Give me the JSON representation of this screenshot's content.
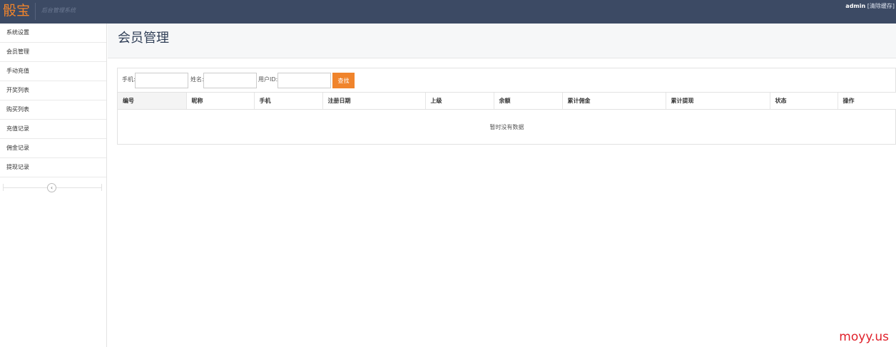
{
  "header": {
    "logo": "骰宝",
    "subtitle": "后台管理系统",
    "user": "admin",
    "clear_cache": "[清除缓存]"
  },
  "sidebar": {
    "items": [
      {
        "label": "系统设置"
      },
      {
        "label": "会员管理"
      },
      {
        "label": "手动充值"
      },
      {
        "label": "开奖列表"
      },
      {
        "label": "购买列表"
      },
      {
        "label": "充值记录"
      },
      {
        "label": "佣金记录"
      },
      {
        "label": "提现记录"
      }
    ],
    "collapse_icon": "chevron-left-icon"
  },
  "page": {
    "title": "会员管理"
  },
  "search": {
    "phone_label": "手机:",
    "phone_value": "",
    "name_label": "姓名:",
    "name_value": "",
    "userid_label": "用户ID:",
    "userid_value": "",
    "button": "查找"
  },
  "table": {
    "columns": [
      "编号",
      "昵称",
      "手机",
      "注册日期",
      "上级",
      "余额",
      "累计佣金",
      "累计提现",
      "状态",
      "操作"
    ],
    "empty_text": "暂时没有数据"
  },
  "watermark": "moyy.us",
  "colors": {
    "topbar": "#3c4a64",
    "brand": "#f0842c",
    "watermark": "#e0202a"
  }
}
